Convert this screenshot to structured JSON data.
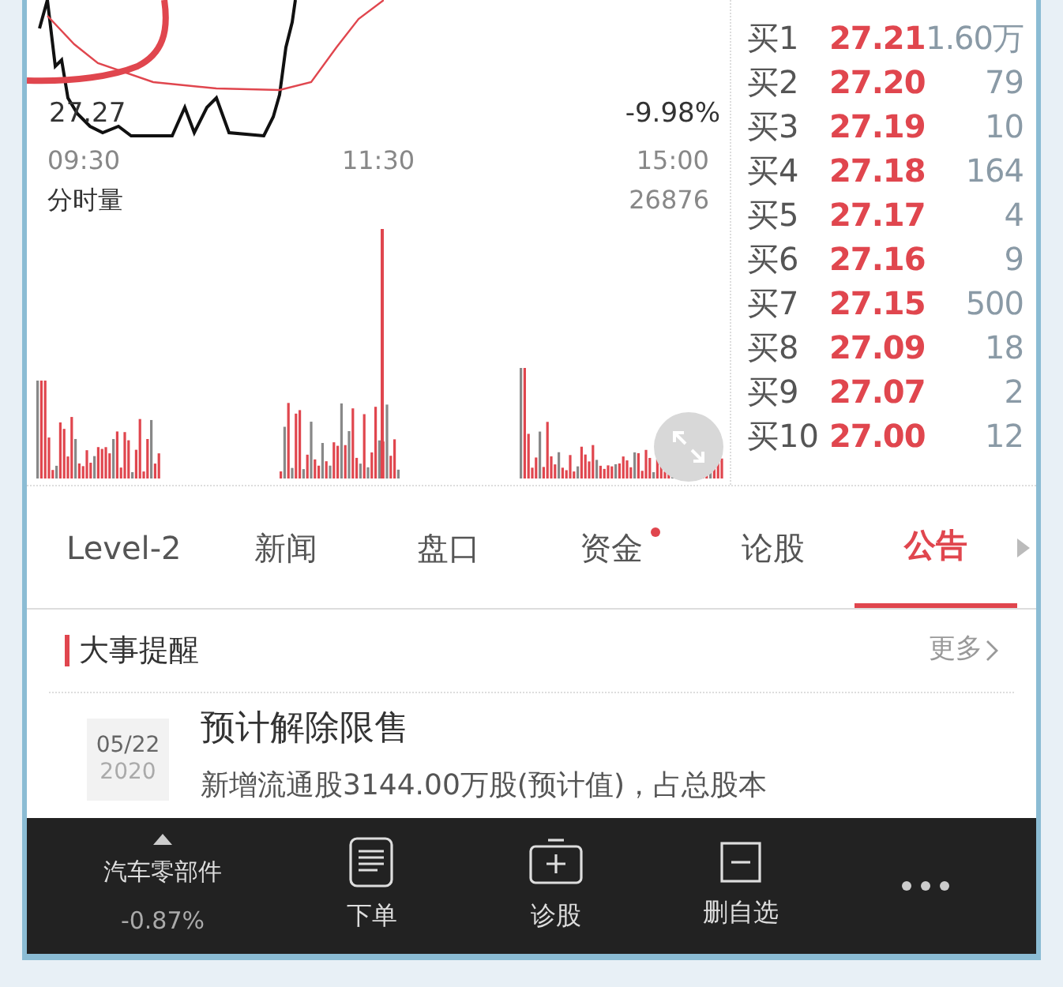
{
  "price_chart": {
    "low_label": "27.27",
    "change_label": "-9.98%"
  },
  "time_axis": [
    "09:30",
    "11:30",
    "15:00"
  ],
  "volume_chart": {
    "title": "分时量",
    "value": "26876"
  },
  "order_book": [
    {
      "level": "买1",
      "price": "27.21",
      "volume": "1.60万"
    },
    {
      "level": "买2",
      "price": "27.20",
      "volume": "79"
    },
    {
      "level": "买3",
      "price": "27.19",
      "volume": "10"
    },
    {
      "level": "买4",
      "price": "27.18",
      "volume": "164"
    },
    {
      "level": "买5",
      "price": "27.17",
      "volume": "4"
    },
    {
      "level": "买6",
      "price": "27.16",
      "volume": "9"
    },
    {
      "level": "买7",
      "price": "27.15",
      "volume": "500"
    },
    {
      "level": "买8",
      "price": "27.09",
      "volume": "18"
    },
    {
      "level": "买9",
      "price": "27.07",
      "volume": "2"
    },
    {
      "level": "买10",
      "price": "27.00",
      "volume": "12"
    }
  ],
  "tabs": [
    {
      "label": "Level-2",
      "selected": false,
      "dot": false
    },
    {
      "label": "新闻",
      "selected": false,
      "dot": false
    },
    {
      "label": "盘口",
      "selected": false,
      "dot": false
    },
    {
      "label": "资金",
      "selected": false,
      "dot": true
    },
    {
      "label": "论股",
      "selected": false,
      "dot": false
    },
    {
      "label": "公告",
      "selected": true,
      "dot": false
    }
  ],
  "section": {
    "title": "大事提醒",
    "more": "更多"
  },
  "events": [
    {
      "date": "05/22",
      "year": "2020",
      "title": "预计解除限售",
      "text": "新增流通股3144.00万股(预计值)，占总股本"
    }
  ],
  "bottom_bar": {
    "sector": {
      "name": "汽车零部件",
      "change": "-0.87%"
    },
    "actions": [
      {
        "kind": "order",
        "label": "下单"
      },
      {
        "kind": "diagnose",
        "label": "诊股"
      },
      {
        "kind": "remove",
        "label": "删自选"
      },
      {
        "kind": "more"
      }
    ]
  }
}
